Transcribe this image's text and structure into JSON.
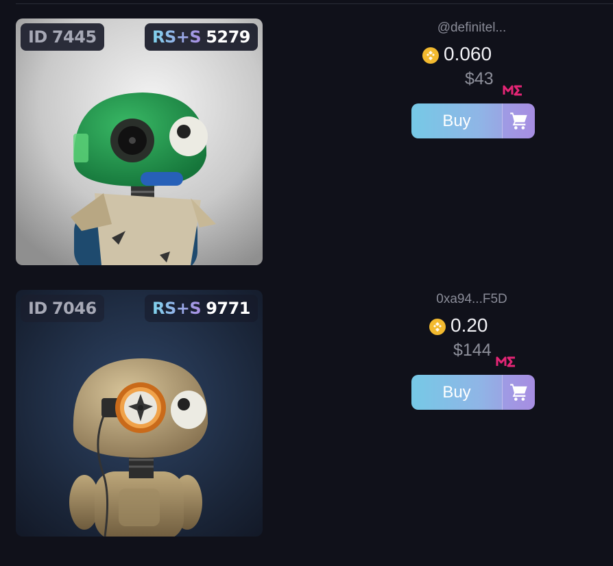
{
  "listings": [
    {
      "id_label": "ID",
      "id_number": "7445",
      "rs_label": "RS+S",
      "rs_score": "5279",
      "seller": "@definitel...",
      "price": "0.060",
      "usd": "$43",
      "buy_label": "Buy",
      "currency_icon": "bnb-coin-icon",
      "marketplace_icon": "magic-eden-icon",
      "cart_icon": "shopping-cart-icon"
    },
    {
      "id_label": "ID",
      "id_number": "7046",
      "rs_label": "RS+S",
      "rs_score": "9771",
      "seller": "0xa94...F5D",
      "price": "0.20",
      "usd": "$144",
      "buy_label": "Buy",
      "currency_icon": "bnb-coin-icon",
      "marketplace_icon": "magic-eden-icon",
      "cart_icon": "shopping-cart-icon"
    }
  ],
  "colors": {
    "background": "#10111a",
    "accent_start": "#76c9e6",
    "accent_end": "#a690e0",
    "coin": "#f3ba2f",
    "marketplace": "#e42575"
  }
}
